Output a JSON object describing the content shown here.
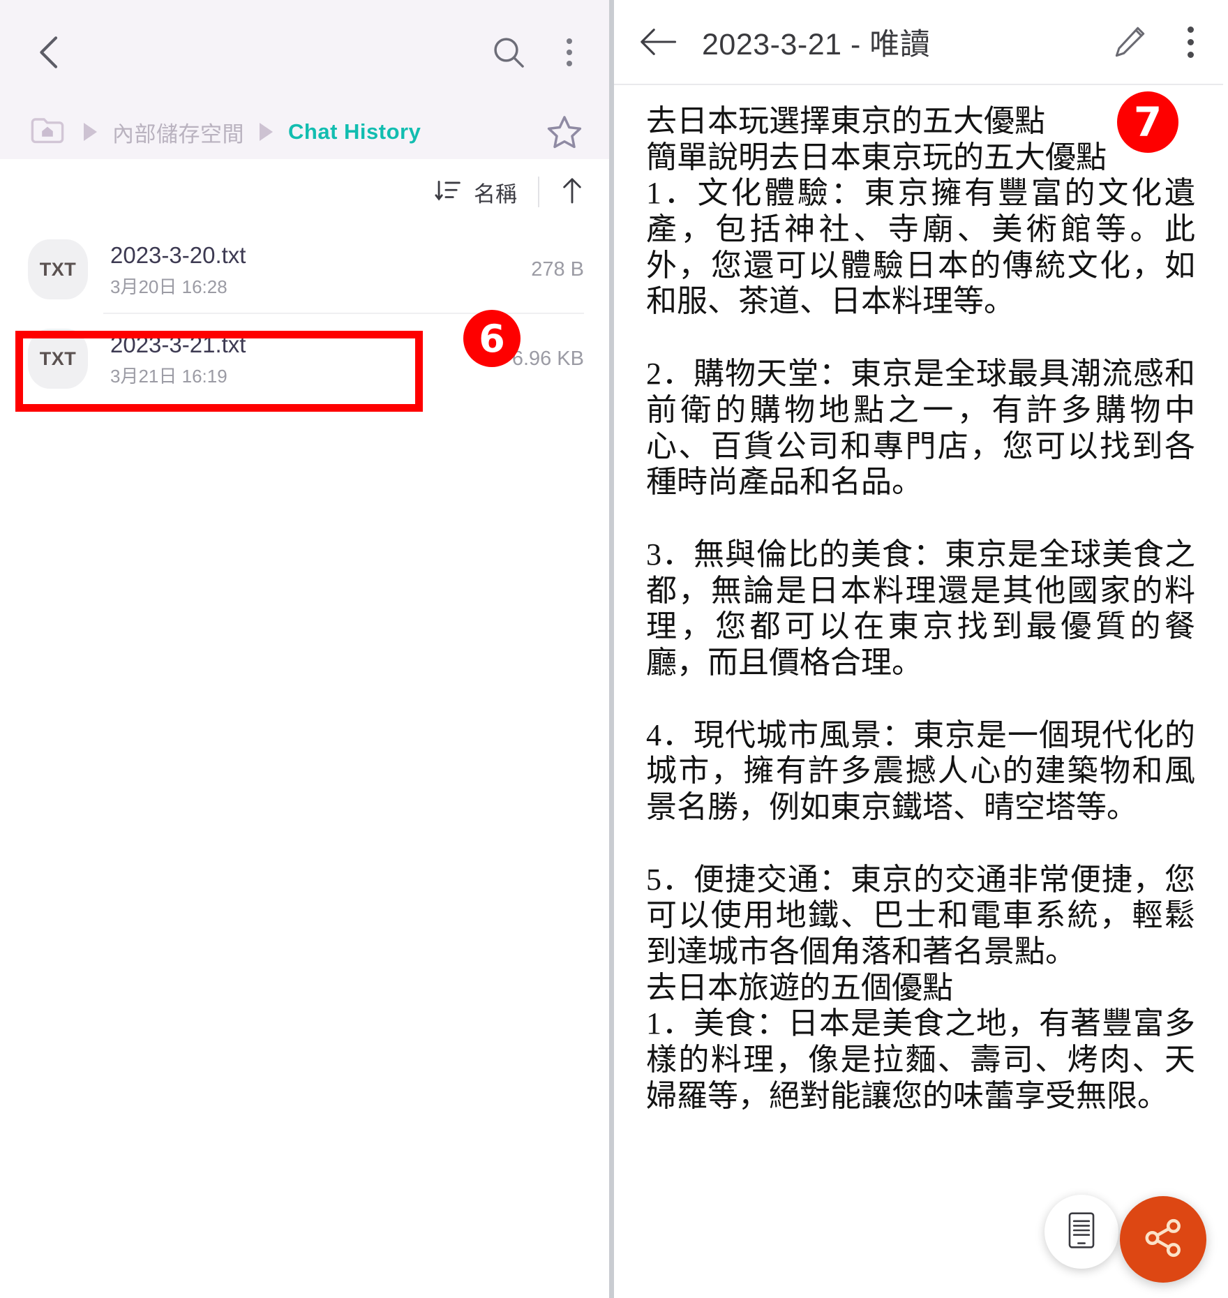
{
  "file_manager": {
    "back_icon": "chevron-left-icon",
    "search_icon": "search-icon",
    "overflow_icon": "kebab-menu-icon",
    "breadcrumb": {
      "home_icon": "home-folder-icon",
      "segments": [
        {
          "label": "內部儲存空間",
          "active": false
        },
        {
          "label": "Chat History",
          "active": true
        }
      ],
      "favorite_icon": "star-outline-icon"
    },
    "sort_bar": {
      "sort_icon": "sort-icon",
      "label": "名稱",
      "direction_icon": "arrow-up-icon"
    },
    "files": [
      {
        "type_label": "TXT",
        "name": "2023-3-20.txt",
        "modified": "3月20日 16:28",
        "size": "278 B"
      },
      {
        "type_label": "TXT",
        "name": "2023-3-21.txt",
        "modified": "3月21日 16:19",
        "size": "6.96 KB"
      }
    ]
  },
  "text_viewer": {
    "back_icon": "arrow-left-icon",
    "title": "2023-3-21 - 唯讀",
    "edit_icon": "pencil-icon",
    "overflow_icon": "kebab-menu-icon",
    "paragraphs": [
      "去日本玩選擇東京的五大優點",
      "簡單說明去日本東京玩的五大優點",
      "1．文化體驗：東京擁有豐富的文化遺產，包括神社、寺廟、美術館等。此外，您還可以體驗日本的傳統文化，如和服、茶道、日本料理等。",
      "2．購物天堂：東京是全球最具潮流感和前衛的購物地點之一，有許多購物中心、百貨公司和專門店，您可以找到各種時尚產品和名品。",
      "3．無與倫比的美食：東京是全球美食之都，無論是日本料理還是其他國家的料理，您都可以在東京找到最優質的餐廳，而且價格合理。",
      "4．現代城市風景：東京是一個現代化的城市，擁有許多震撼人心的建築物和風景名勝，例如東京鐵塔、晴空塔等。",
      "5．便捷交通：東京的交通非常便捷，您可以使用地鐵、巴士和電車系統，輕鬆到達城市各個角落和著名景點。",
      "去日本旅遊的五個優點",
      "1．美食：日本是美食之地，有著豐富多樣的料理，像是拉麵、壽司、烤肉、天婦羅等，絕對能讓您的味蕾享受無限。"
    ],
    "fab_reader_icon": "reading-mode-icon",
    "fab_share_icon": "share-icon"
  },
  "annotations": {
    "badge_6": "6",
    "badge_7": "7",
    "highlight_color": "#fe0000"
  },
  "colors": {
    "accent_teal": "#12bdb0",
    "annotation_red": "#fe0000",
    "share_orange": "#dd4713",
    "header_bg": "#f6f3f8"
  }
}
